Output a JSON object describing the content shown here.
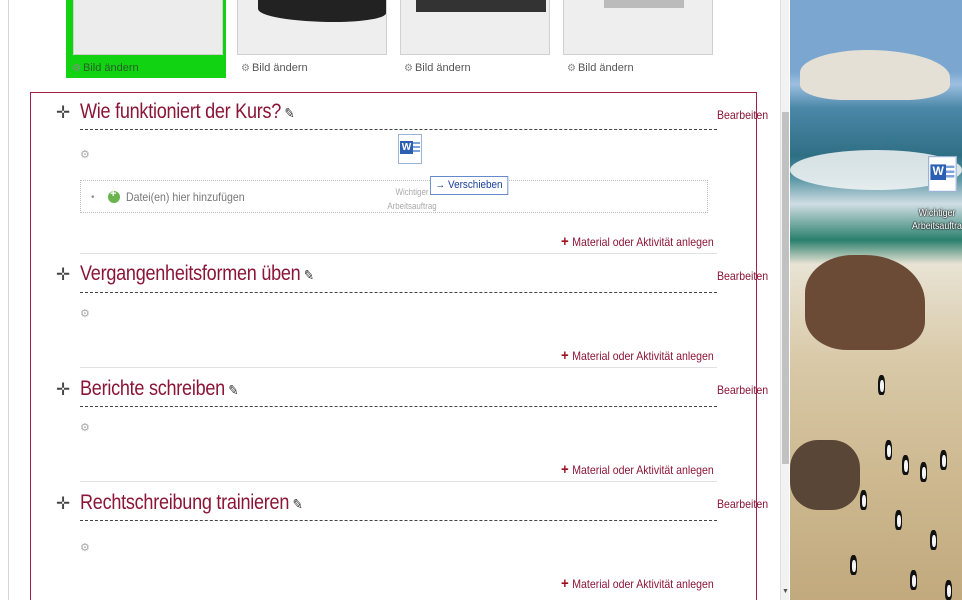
{
  "image_tiles": [
    {
      "caption": "Bild ändern",
      "active": true
    },
    {
      "caption": "Bild ändern",
      "active": false
    },
    {
      "caption": "Bild ändern",
      "active": false
    },
    {
      "caption": "Bild ändern",
      "active": false
    }
  ],
  "sections": [
    {
      "title": "Wie funktioniert der Kurs?",
      "edit": "Bearbeiten",
      "add_activity": "Material oder Aktivität anlegen"
    },
    {
      "title": "Vergangenheitsformen üben",
      "edit": "Bearbeiten",
      "add_activity": "Material oder Aktivität anlegen"
    },
    {
      "title": "Berichte schreiben",
      "edit": "Bearbeiten",
      "add_activity": "Material oder Aktivität anlegen"
    },
    {
      "title": "Rechtschreibung trainieren",
      "edit": "Bearbeiten",
      "add_activity": "Material oder Aktivität anlegen"
    }
  ],
  "dropzone": {
    "label": "Datei(en) hier hinzufügen"
  },
  "drag": {
    "file_caption_line1": "Wichtiger",
    "file_caption_line2": "Arbeitsauftrag",
    "tooltip": "→ Verschieben"
  },
  "desktop": {
    "icon_caption_line1": "Wichtiger",
    "icon_caption_line2": "Arbeitsauftra"
  },
  "colors": {
    "accent": "#8a1538",
    "box_border": "#9b2145",
    "active_tile": "#12d312"
  },
  "icons": {
    "move": "move-cross-icon",
    "edit": "pencil-icon",
    "settings": "gear-icon",
    "add": "plus-icon",
    "file": "word-document-icon"
  }
}
